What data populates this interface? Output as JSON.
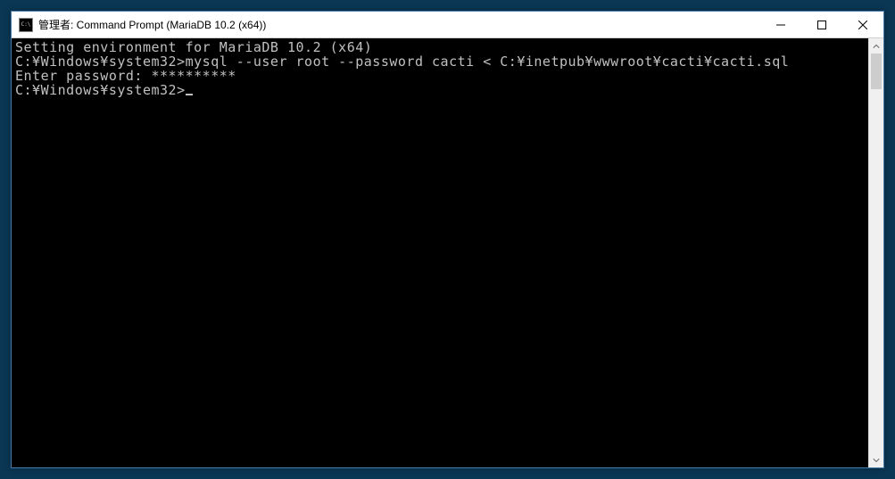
{
  "window": {
    "title": "管理者: Command Prompt (MariaDB 10.2 (x64))"
  },
  "terminal": {
    "line1": "Setting environment for MariaDB 10.2 (x64)",
    "blank1": "",
    "line2": "C:¥Windows¥system32>mysql --user root --password cacti < C:¥inetpub¥wwwroot¥cacti¥cacti.sql",
    "line3": "Enter password: **********",
    "blank2": "",
    "prompt": "C:¥Windows¥system32>"
  }
}
